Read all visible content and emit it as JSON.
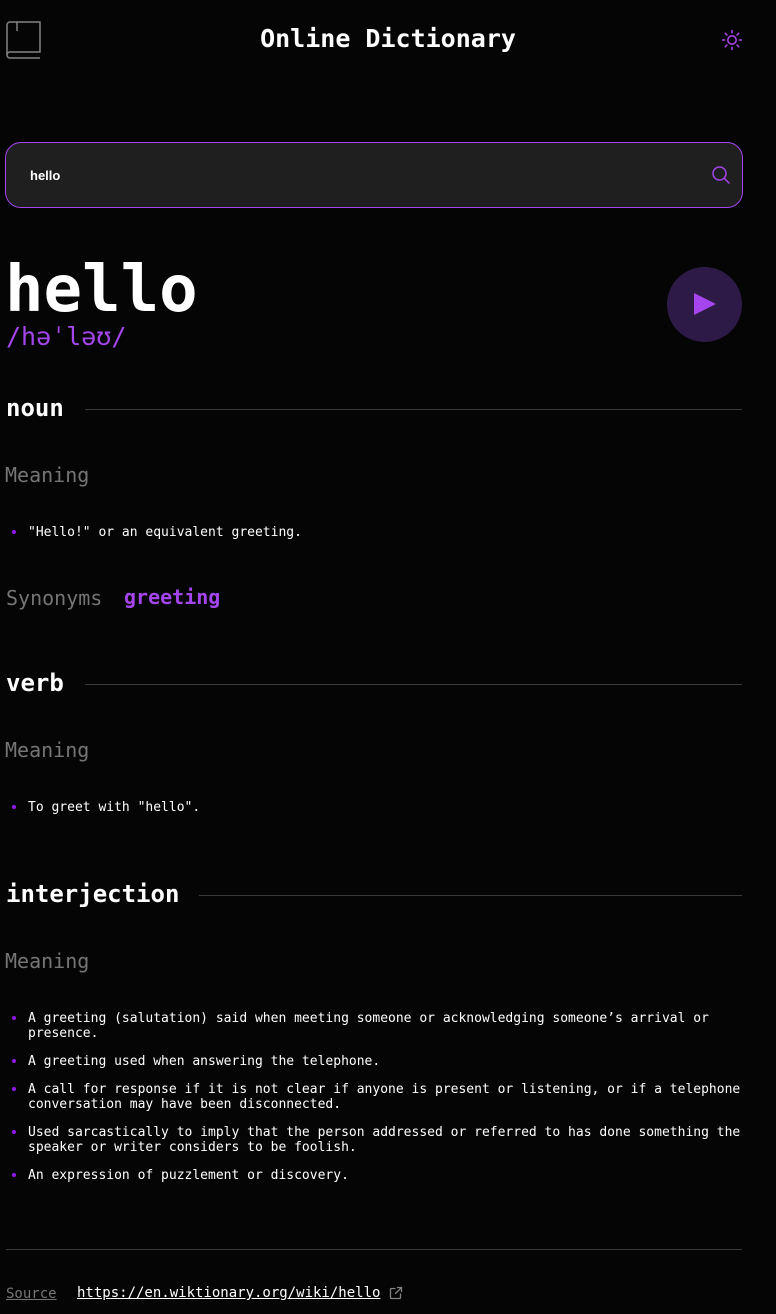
{
  "header": {
    "title": "Online Dictionary",
    "logo_icon": "book-icon",
    "theme_icon": "sun-icon"
  },
  "search": {
    "value": "hello",
    "icon": "search-icon"
  },
  "entry": {
    "word": "hello",
    "phonetic": "/həˈləʊ/",
    "play_icon": "play-icon"
  },
  "meanings": [
    {
      "part_of_speech": "noun",
      "meaning_label": "Meaning",
      "definitions": [
        "\"Hello!\" or an equivalent greeting."
      ],
      "synonyms_label": "Synonyms",
      "synonyms": [
        "greeting"
      ]
    },
    {
      "part_of_speech": "verb",
      "meaning_label": "Meaning",
      "definitions": [
        "To greet with \"hello\"."
      ]
    },
    {
      "part_of_speech": "interjection",
      "meaning_label": "Meaning",
      "definitions": [
        "A greeting (salutation) said when meeting someone or acknowledging someone’s arrival or presence.",
        "A greeting used when answering the telephone.",
        "A call for response if it is not clear if anyone is present or listening, or if a telephone conversation may have been disconnected.",
        "Used sarcastically to imply that the person addressed or referred to has done something the speaker or writer considers to be foolish.",
        "An expression of puzzlement or discovery."
      ]
    }
  ],
  "footer": {
    "source_label": "Source",
    "source_url": "https://en.wiktionary.org/wiki/hello",
    "link_icon": "external-link-icon"
  },
  "colors": {
    "accent": "#a445ed",
    "background": "#050505",
    "input_background": "#1f1f1f",
    "muted_text": "#757575"
  }
}
